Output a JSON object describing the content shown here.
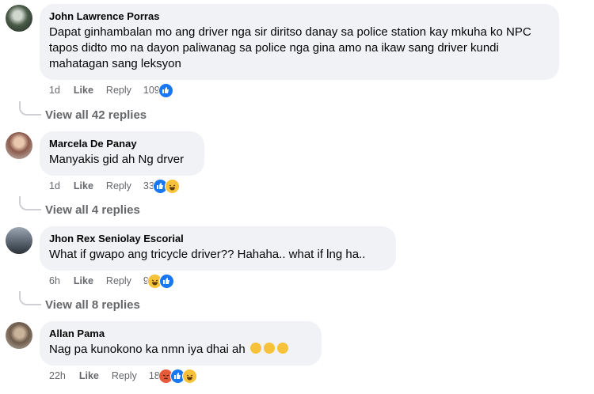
{
  "comments": [
    {
      "author": "John Lawrence Porras",
      "text": "Dapat ginhambalan mo ang driver nga sir diritso danay sa police station kay mkuha ko NPC tapos didto mo na dayon paliwanag sa police nga gina amo na ikaw sang driver kundi mahatagan sang leksyon",
      "time": "1d",
      "like_label": "Like",
      "reply_label": "Reply",
      "reaction_count": "109",
      "reactions": [
        "like-reaction-icon"
      ],
      "view_replies": "View all 42 replies"
    },
    {
      "author": "Marcela De Panay",
      "text": "Manyakis gid ah Ng drver",
      "time": "1d",
      "like_label": "Like",
      "reply_label": "Reply",
      "reaction_count": "33",
      "reactions": [
        "like-reaction-icon",
        "haha-reaction-icon"
      ],
      "view_replies": "View all 4 replies"
    },
    {
      "author": "Jhon Rex Seniolay Escorial",
      "text": "What if gwapo ang tricycle driver?? Hahaha.. what if lng ha..",
      "time": "6h",
      "like_label": "Like",
      "reply_label": "Reply",
      "reaction_count": "9",
      "reactions": [
        "haha-reaction-icon",
        "like-reaction-icon"
      ],
      "view_replies": "View all 8 replies"
    },
    {
      "author": "Allan Pama",
      "text": "Nag pa kunokono ka nmn iya dhai ah",
      "text_emojis": [
        "rolling-laugh-emoji",
        "rolling-laugh-emoji",
        "rolling-laugh-emoji"
      ],
      "time": "22h",
      "like_label": "Like",
      "reply_label": "Reply",
      "reaction_count": "18",
      "reactions": [
        "angry-reaction-icon",
        "like-reaction-icon",
        "haha-reaction-icon"
      ]
    }
  ],
  "colors": {
    "bubble_bg": "#f0f2f5",
    "meta_text": "#65676b",
    "like_blue": "#1877f2",
    "haha_yellow": "#f7c23a",
    "angry_orange": "#e65a3a"
  }
}
